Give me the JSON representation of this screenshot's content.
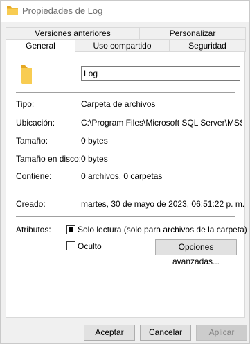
{
  "window": {
    "title": "Propiedades de Log"
  },
  "tabs": {
    "row1": [
      "Versiones anteriores",
      "Personalizar"
    ],
    "row2": [
      "General",
      "Uso compartido",
      "Seguridad"
    ],
    "active": "General"
  },
  "general": {
    "name_value": "Log",
    "type_label": "Tipo:",
    "type_value": "Carpeta de archivos",
    "location_label": "Ubicación:",
    "location_value": "C:\\Program Files\\Microsoft SQL Server\\MSSQL",
    "size_label": "Tamaño:",
    "size_value": "0 bytes",
    "size_on_disk_label": "Tamaño en disco:",
    "size_on_disk_value": "0 bytes",
    "contains_label": "Contiene:",
    "contains_value": "0 archivos, 0 carpetas",
    "created_label": "Creado:",
    "created_value": "martes, 30 de mayo de 2023, 06:51:22 p. m.",
    "attributes_label": "Atributos:",
    "readonly_label": "Solo lectura (solo para archivos de la carpeta)",
    "readonly_state": "indeterminate",
    "hidden_label": "Oculto",
    "hidden_checked": false,
    "advanced_button": "Opciones avanzadas..."
  },
  "footer": {
    "accept": "Aceptar",
    "cancel": "Cancelar",
    "apply": "Aplicar"
  },
  "colors": {
    "folder": "#f8cc52",
    "folder_dark": "#e5a823",
    "window_bg": "#f0f0f0",
    "panel_bg": "#ffffff"
  }
}
